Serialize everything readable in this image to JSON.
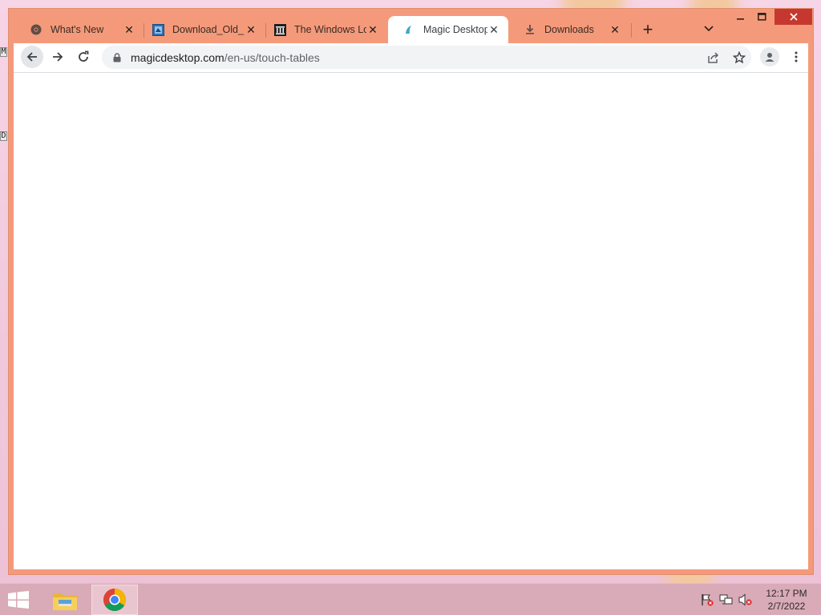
{
  "desktop": {
    "icons": [
      {
        "glyph": "M"
      },
      {
        "glyph": "D"
      }
    ]
  },
  "browser": {
    "tabs": [
      {
        "title": "What's New",
        "icon": "chrome-icon",
        "active": false
      },
      {
        "title": "Download_Old_I",
        "icon": "download-old-site-icon",
        "active": false
      },
      {
        "title": "The Windows Lo",
        "icon": "museum-icon",
        "active": false
      },
      {
        "title": "Magic Desktop",
        "icon": "magic-desktop-icon",
        "active": true
      },
      {
        "title": "Downloads",
        "icon": "download-icon",
        "active": false
      }
    ],
    "newtab_glyph": "+",
    "address": {
      "host": "magicdesktop.com",
      "path": "/en-us/touch-tables"
    },
    "colors": {
      "frame": "#f49a7a",
      "close_button": "#c6382f"
    }
  },
  "taskbar": {
    "apps": [
      "file-explorer",
      "google-chrome"
    ],
    "clock": {
      "time": "12:17 PM",
      "date": "2/7/2022"
    }
  }
}
